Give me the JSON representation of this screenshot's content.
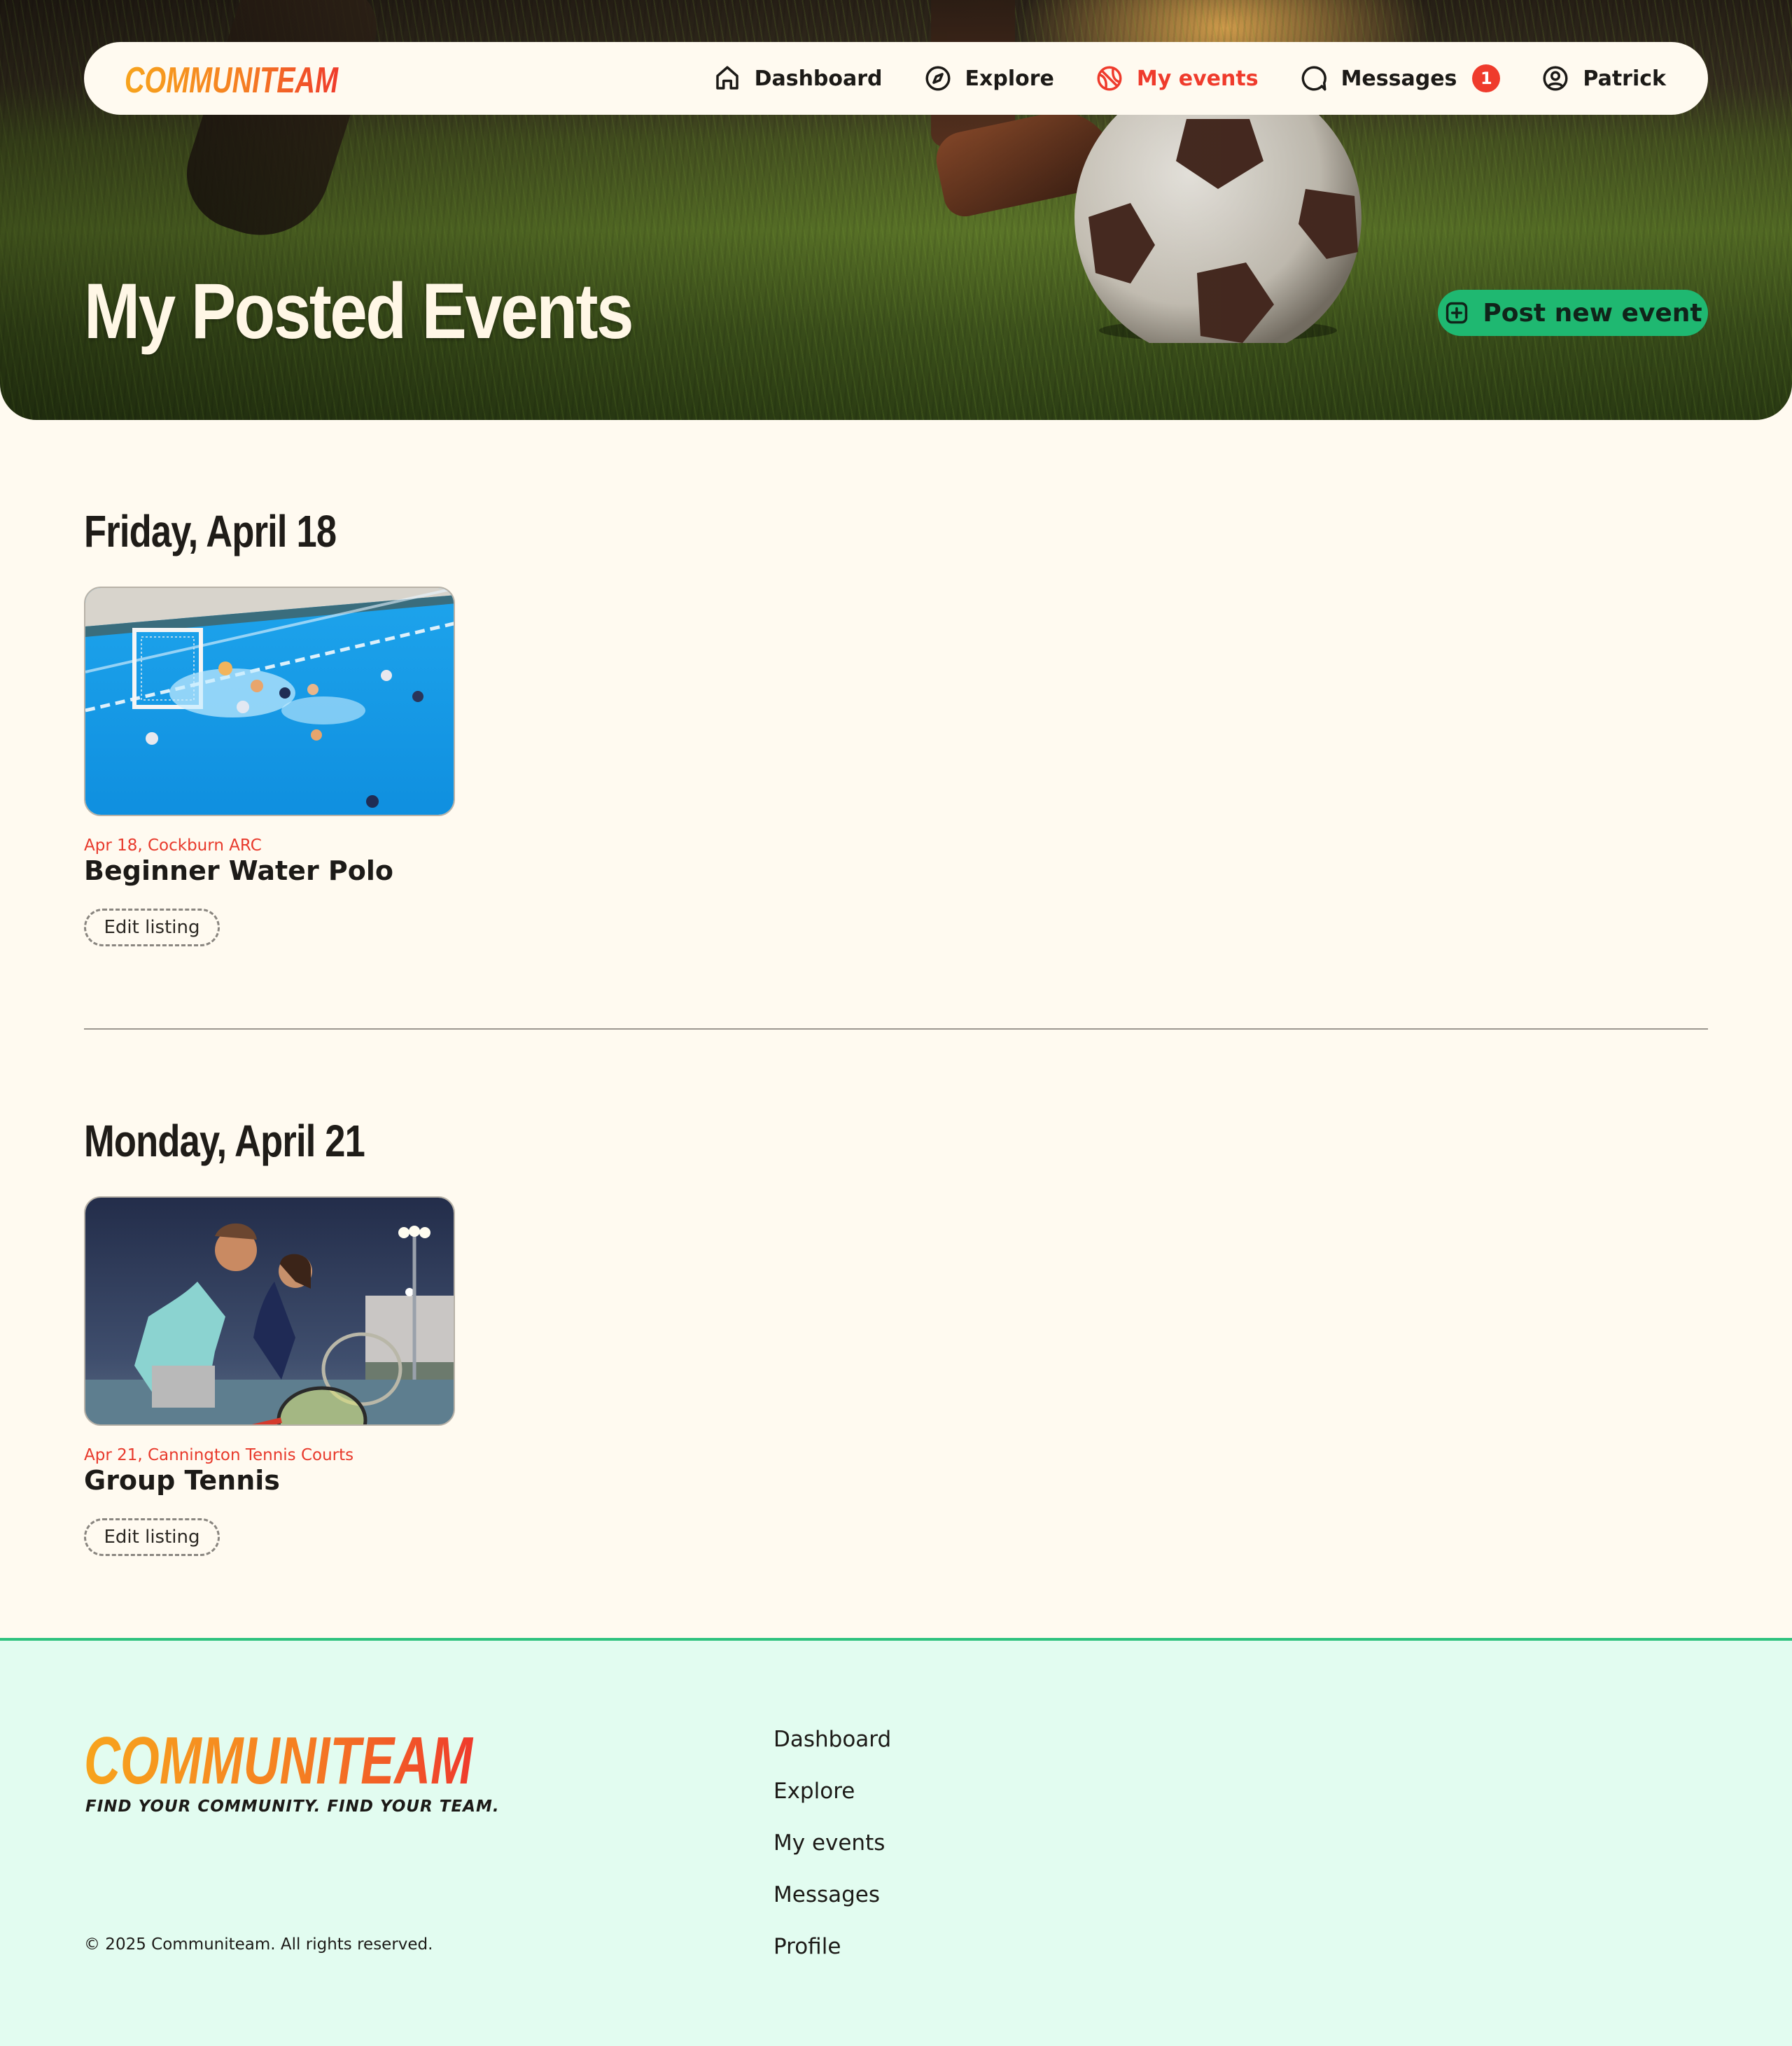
{
  "brand": {
    "name_part1": "COMMUNI",
    "name_part2": "TEAM",
    "tagline": "FIND YOUR COMMUNITY. FIND YOUR TEAM.",
    "color_orange": "#f7941d",
    "color_red": "#ef3b2c",
    "color_green": "#1fb871"
  },
  "nav": {
    "items": [
      {
        "label": "Dashboard",
        "icon": "home-icon"
      },
      {
        "label": "Explore",
        "icon": "compass-icon"
      },
      {
        "label": "My events",
        "icon": "ball-icon",
        "active": true
      },
      {
        "label": "Messages",
        "icon": "chat-bubble-icon",
        "badge": "1"
      },
      {
        "label": "Patrick",
        "icon": "user-circle-icon"
      }
    ]
  },
  "hero": {
    "title": "My Posted Events",
    "post_button_label": "Post new event",
    "post_button_icon": "plus-square-icon"
  },
  "sections": [
    {
      "date_heading": "Friday, April 18",
      "events": [
        {
          "meta": "Apr 18, Cockburn ARC",
          "title": "Beginner Water Polo",
          "edit_label": "Edit listing",
          "image": "water-polo-photo"
        }
      ]
    },
    {
      "date_heading": "Monday, April 21",
      "events": [
        {
          "meta": "Apr 21, Cannington Tennis Courts",
          "title": "Group Tennis",
          "edit_label": "Edit listing",
          "image": "tennis-photo"
        }
      ]
    }
  ],
  "footer": {
    "links": [
      "Dashboard",
      "Explore",
      "My events",
      "Messages",
      "Profile"
    ],
    "copyright": "© 2025 Communiteam. All rights reserved."
  }
}
